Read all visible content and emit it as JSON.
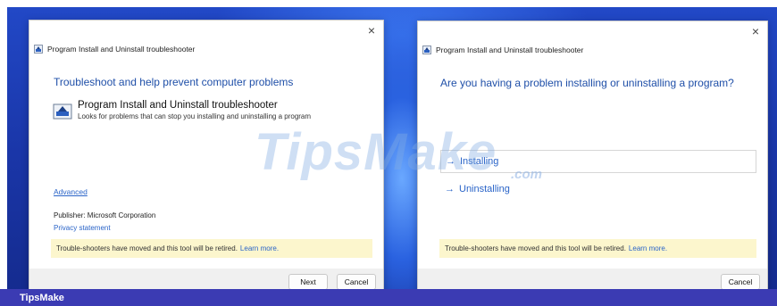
{
  "left_window": {
    "title": "Program Install and Uninstall troubleshooter",
    "close_glyph": "×",
    "heading": "Troubleshoot and help prevent computer problems",
    "tool_name": "Program Install and Uninstall troubleshooter",
    "tool_desc": "Looks for problems that can stop you installing and uninstalling a program",
    "advanced_link": "Advanced",
    "publisher": "Publisher:  Microsoft Corporation",
    "privacy_link": "Privacy statement",
    "notice_text": "Trouble-shooters have moved and this tool will be retired.",
    "notice_link": "Learn more.",
    "next_label": "Next",
    "cancel_label": "Cancel",
    "icons": {
      "title": "troubleshooter-icon",
      "tool": "troubleshooter-icon"
    }
  },
  "right_window": {
    "title": "Program Install and Uninstall troubleshooter",
    "close_glyph": "×",
    "heading": "Are you having a problem installing or uninstalling a program?",
    "options": [
      {
        "arrow": "→",
        "label": "Installing"
      },
      {
        "arrow": "→",
        "label": "Uninstalling"
      }
    ],
    "notice_text": "Trouble-shooters have moved and this tool will be retired.",
    "notice_link": "Learn more.",
    "cancel_label": "Cancel"
  },
  "watermark": {
    "main": "TipsMake",
    "suffix": ".com"
  },
  "brand_bar": {
    "label": "TipsMake"
  },
  "colors": {
    "accent_blue": "#2a64c8",
    "heading_blue": "#1f4fa8",
    "notice_bg": "#fcf6cd",
    "brand_bar": "#3b3bb3",
    "desktop": "#1a36a8"
  }
}
